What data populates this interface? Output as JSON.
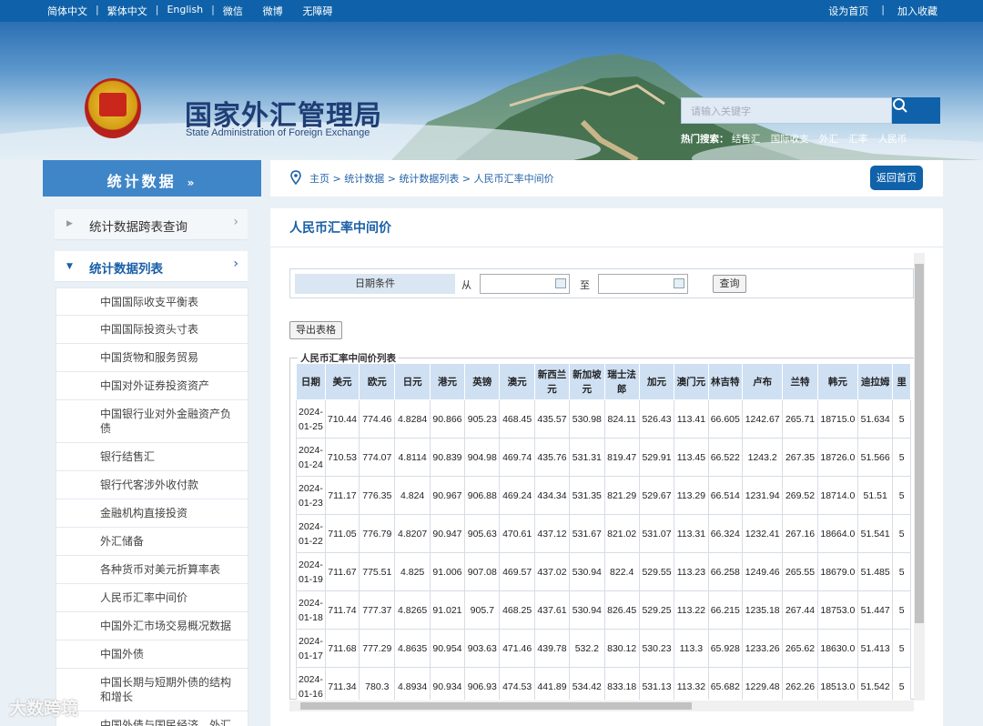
{
  "topbar": {
    "lang_simplified": "简体中文",
    "lang_traditional": "繁体中文",
    "lang_english": "English",
    "wechat": "微信",
    "weibo": "微博",
    "accessibility": "无障碍",
    "set_home": "设为首页",
    "favorite": "加入收藏"
  },
  "header": {
    "logo_cn": "国家外汇管理局",
    "logo_en": "State Administration of Foreign Exchange",
    "search_placeholder": "请输入关键字",
    "hot_label": "热门搜索：",
    "hot_terms": [
      "结售汇",
      "国际收支",
      "外汇",
      "汇率",
      "人民币"
    ]
  },
  "sidebar": {
    "title": "统计数据",
    "sub1": "统计数据跨表查询",
    "sub2": "统计数据列表",
    "items": [
      "中国国际收支平衡表",
      "中国国际投资头寸表",
      "中国货物和服务贸易",
      "中国对外证券投资资产",
      "中国银行业对外金融资产负债",
      "银行结售汇",
      "银行代客涉外收付款",
      "金融机构直接投资",
      "外汇储备",
      "各种货币对美元折算率表",
      "人民币汇率中间价",
      "中国外汇市场交易概况数据",
      "中国外债",
      "中国长期与短期外债的结构和增长",
      "中国外债与国民经济、外汇"
    ]
  },
  "breadcrumb": {
    "home": "主页",
    "l1": "统计数据",
    "l2": "统计数据列表",
    "l3": "人民币汇率中间价",
    "sep": " > ",
    "back": "返回首页"
  },
  "main": {
    "title": "人民币汇率中间价",
    "date_label": "日期条件",
    "from": "从",
    "to": "至",
    "query": "查询",
    "export": "导出表格",
    "legend": "人民币汇率中间价列表"
  },
  "table": {
    "headers": [
      "日期",
      "美元",
      "欧元",
      "日元",
      "港元",
      "英镑",
      "澳元",
      "新西兰元",
      "新加坡元",
      "瑞士法郎",
      "加元",
      "澳门元",
      "林吉特",
      "卢布",
      "兰特",
      "韩元",
      "迪拉姆",
      "里"
    ],
    "rows": [
      [
        "2024-01-25",
        "710.44",
        "774.46",
        "4.8284",
        "90.866",
        "905.23",
        "468.45",
        "435.57",
        "530.98",
        "824.11",
        "526.43",
        "113.41",
        "66.605",
        "1242.67",
        "265.71",
        "18715.0",
        "51.634",
        "5"
      ],
      [
        "2024-01-24",
        "710.53",
        "774.07",
        "4.8114",
        "90.839",
        "904.98",
        "469.74",
        "435.76",
        "531.31",
        "819.47",
        "529.91",
        "113.45",
        "66.522",
        "1243.2",
        "267.35",
        "18726.0",
        "51.566",
        "5"
      ],
      [
        "2024-01-23",
        "711.17",
        "776.35",
        "4.824",
        "90.967",
        "906.88",
        "469.24",
        "434.34",
        "531.35",
        "821.29",
        "529.67",
        "113.29",
        "66.514",
        "1231.94",
        "269.52",
        "18714.0",
        "51.51",
        "5"
      ],
      [
        "2024-01-22",
        "711.05",
        "776.79",
        "4.8207",
        "90.947",
        "905.63",
        "470.61",
        "437.12",
        "531.67",
        "821.02",
        "531.07",
        "113.31",
        "66.324",
        "1232.41",
        "267.16",
        "18664.0",
        "51.541",
        "5"
      ],
      [
        "2024-01-19",
        "711.67",
        "775.51",
        "4.825",
        "91.006",
        "907.08",
        "469.57",
        "437.02",
        "530.94",
        "822.4",
        "529.55",
        "113.23",
        "66.258",
        "1249.46",
        "265.55",
        "18679.0",
        "51.485",
        "5"
      ],
      [
        "2024-01-18",
        "711.74",
        "777.37",
        "4.8265",
        "91.021",
        "905.7",
        "468.25",
        "437.61",
        "530.94",
        "826.45",
        "529.25",
        "113.22",
        "66.215",
        "1235.18",
        "267.44",
        "18753.0",
        "51.447",
        "5"
      ],
      [
        "2024-01-17",
        "711.68",
        "777.29",
        "4.8635",
        "90.954",
        "903.63",
        "471.46",
        "439.78",
        "532.2",
        "830.12",
        "530.23",
        "113.3",
        "65.928",
        "1233.26",
        "265.62",
        "18630.0",
        "51.413",
        "5"
      ],
      [
        "2024-01-16",
        "711.34",
        "780.3",
        "4.8934",
        "90.934",
        "906.93",
        "474.53",
        "441.89",
        "534.42",
        "833.18",
        "531.13",
        "113.32",
        "65.682",
        "1229.48",
        "262.26",
        "18513.0",
        "51.542",
        "5"
      ]
    ]
  },
  "watermark": "大数跨境"
}
